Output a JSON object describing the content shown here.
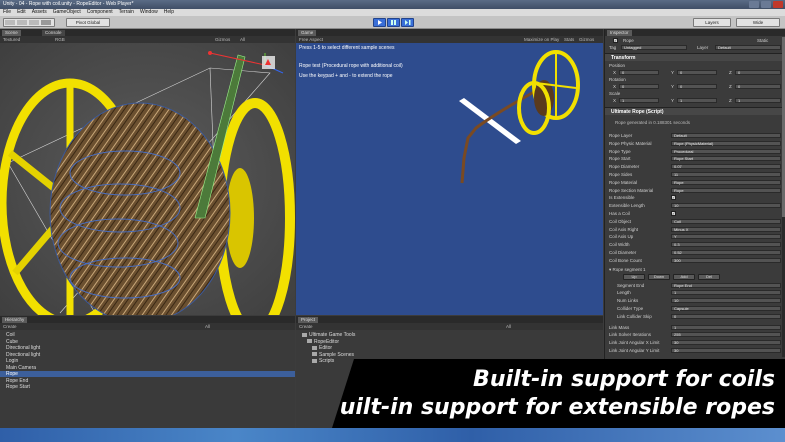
{
  "window": {
    "title": "Unity - 04 - Rope with coil.unity - RopeEditor - Web Player*"
  },
  "menu": [
    "File",
    "Edit",
    "Assets",
    "GameObject",
    "Component",
    "Terrain",
    "Window",
    "Help"
  ],
  "toolbar": {
    "pivot": "Pivot",
    "global": "Global",
    "layers": "Layers",
    "layout": "Wide"
  },
  "scene": {
    "tabs": [
      "Scene",
      "Console"
    ],
    "mode": "Textured",
    "color": "RGB",
    "gizmos": "Gizmos",
    "search": "All"
  },
  "game": {
    "tab": "Game",
    "aspect": "Free Aspect",
    "controls": [
      "Maximize on Play",
      "Stats",
      "Gizmos"
    ],
    "lines": [
      "Press 1-5 to select different sample scenes",
      "Rope test (Procedural rope with additional coil)",
      "Use the keypad + and - to extend the rope"
    ]
  },
  "inspector": {
    "tab": "Inspector",
    "object_name": "Rope",
    "static": "Static",
    "tag_label": "Tag",
    "tag_value": "Untagged",
    "layer_label": "Layer",
    "layer_value": "Default",
    "transform": {
      "title": "Transform",
      "position": "Position",
      "rotation": "Rotation",
      "scale": "Scale",
      "pos": [
        "0",
        "0",
        "0"
      ],
      "rot": [
        "0",
        "0",
        "0"
      ],
      "scl": [
        "1",
        "1",
        "1"
      ],
      "axes": [
        "X",
        "Y",
        "Z"
      ]
    },
    "script": {
      "title": "Ultimate Rope (Script)",
      "info": "Rope generated in 0.188301 seconds"
    },
    "props": [
      {
        "label": "Rope Layer",
        "value": "Default"
      },
      {
        "label": "Rope Physic Material",
        "value": "Rope (PhysicMaterial)"
      },
      {
        "label": "Rope Type",
        "value": "Procedural"
      },
      {
        "label": "Rope Start",
        "value": "Rope Start"
      },
      {
        "label": "Rope Diameter",
        "value": "0.07"
      },
      {
        "label": "Rope Sides",
        "value": "11"
      },
      {
        "label": "Rope Material",
        "value": "Rope"
      },
      {
        "label": "Rope Section Material",
        "value": "Rope"
      },
      {
        "label": "Is Extensible",
        "value": "☑"
      },
      {
        "label": "Extensible Length",
        "value": "10"
      },
      {
        "label": "Has a Coil",
        "value": "☑"
      },
      {
        "label": "Coil Object",
        "value": "Coil"
      },
      {
        "label": "Coil Axis Right",
        "value": "Minus X"
      },
      {
        "label": "Coil Axis Up",
        "value": "Y"
      },
      {
        "label": "Coil Width",
        "value": "0.3"
      },
      {
        "label": "Coil Diameter",
        "value": "0.52"
      },
      {
        "label": "Coil Bone Count",
        "value": "300"
      }
    ],
    "segment": {
      "title": "Rope segment 1",
      "buttons": [
        "Up",
        "Down",
        "Add",
        "Del"
      ],
      "props": [
        {
          "label": "Segment End",
          "value": "Rope End"
        },
        {
          "label": "Length",
          "value": "1"
        },
        {
          "label": "Num Links",
          "value": "10"
        },
        {
          "label": "Collider Type",
          "value": "Capsule"
        },
        {
          "label": "Link Collider Skip",
          "value": "0"
        }
      ]
    },
    "tail": [
      {
        "label": "Link Mass",
        "value": "1"
      },
      {
        "label": "Link Solver Iterations",
        "value": "255"
      },
      {
        "label": "Link Joint Angular X Limit",
        "value": "30"
      },
      {
        "label": "Link Joint Angular Y Limit",
        "value": "30"
      }
    ]
  },
  "hierarchy": {
    "tab": "Hierarchy",
    "create": "Create",
    "search": "All",
    "items": [
      "Coil",
      "Cube",
      "Directional light",
      "Directional light",
      "Login",
      "Main Camera",
      "Rope",
      "Rope End",
      "Rope Start"
    ],
    "selected_index": 6
  },
  "project": {
    "tab": "Project",
    "create": "Create",
    "search": "All",
    "items": [
      "Ultimate Game Tools",
      "RopeEditor",
      "Editor",
      "Sample Scenes",
      "Scripts"
    ]
  },
  "banner": {
    "line1": "Built-in support for coils",
    "line2": "Built-in support for extensible ropes"
  },
  "colors": {
    "accent": "#3c5f9b",
    "game_bg": "#2e4c8e",
    "spool_yellow": "#f2e000",
    "rope_brown": "#7a4a22"
  }
}
